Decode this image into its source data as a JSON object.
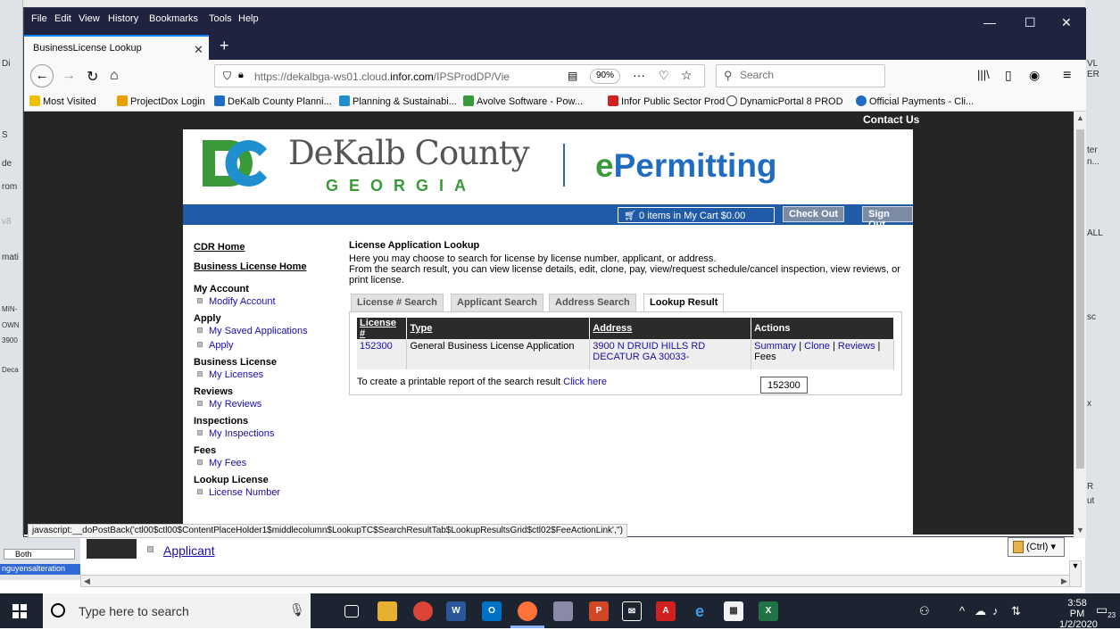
{
  "browser": {
    "menus": [
      "File",
      "Edit",
      "View",
      "History",
      "Bookmarks",
      "Tools",
      "Help"
    ],
    "tab_title": "BusinessLicense Lookup",
    "url_prefix": "https://dekalbga-ws01.cloud.",
    "url_domain": "infor.com",
    "url_suffix": "/IPSProdDP/Vie",
    "zoom": "90%",
    "search_placeholder": "Search",
    "bookmarks": [
      {
        "label": "Most Visited",
        "color": "#f0c000"
      },
      {
        "label": "ProjectDox Login",
        "color": "#e8a000"
      },
      {
        "label": "DeKalb County Planni...",
        "color": "#1f6cc0"
      },
      {
        "label": "Planning & Sustainabi...",
        "color": "#1f8fd0"
      },
      {
        "label": "Avolve Software - Pow...",
        "color": "#3a9a3a"
      },
      {
        "label": "Infor Public Sector Prod",
        "color": "#d02020"
      },
      {
        "label": "DynamicPortal 8 PROD",
        "color": "#444444"
      },
      {
        "label": "Official Payments - Cli...",
        "color": "#1f6cc0"
      }
    ],
    "status_text": "javascript:__doPostBack('ctl00$ctl00$ContentPlaceHolder1$middlecolumn$LookupTC$SearchResultTab$LookupResultsGrid$ctl02$FeeActionLink','')"
  },
  "page": {
    "contact_us": "Contact Us",
    "logo_county": "DeKalb County",
    "logo_state": "GEORGIA",
    "logo_epermit_e": "e",
    "logo_epermit_rest": "Permitting",
    "cart": {
      "count": "0",
      "items_in": "items in",
      "my_cart": "My Cart",
      "amount": "$0.00"
    },
    "check_out": "Check Out",
    "sign_out": "Sign Out",
    "nav": {
      "cdr_home": "CDR Home",
      "business_license_home": "Business License Home",
      "my_account": "My Account",
      "modify_account": "Modify Account",
      "apply": "Apply",
      "my_saved_applications": "My Saved Applications",
      "apply_link": "Apply",
      "business_license": "Business License",
      "my_licenses": "My Licenses",
      "reviews": "Reviews",
      "my_reviews": "My Reviews",
      "inspections": "Inspections",
      "my_inspections": "My Inspections",
      "fees": "Fees",
      "my_fees": "My Fees",
      "lookup_license": "Lookup License",
      "license_number": "License Number",
      "applicant": "Applicant"
    },
    "main": {
      "title": "License Application Lookup",
      "desc1": "Here you may choose to search for license by license number, applicant, or address.",
      "desc2": "From the search result, you can view license details, edit, clone, pay, view/request schedule/cancel inspection, view reviews, or print license.",
      "tabs": [
        "License # Search",
        "Applicant Search",
        "Address Search",
        "Lookup Result"
      ],
      "columns": [
        "License #",
        "Type",
        "Address",
        "Actions"
      ],
      "row": {
        "license": "152300",
        "type": "General Business License Application",
        "address": "3900 N DRUID HILLS RD DECATUR GA 30033-",
        "summary": "Summary",
        "clone": "Clone",
        "reviews": "Reviews",
        "fees": "Fees"
      },
      "printable_text": "To create a printable report of the search result",
      "click_here": "Click here",
      "tooltip": "152300"
    }
  },
  "background": {
    "left_labels": [
      "Di",
      "S",
      "de",
      "rom",
      "v8",
      "mati",
      "MIN-",
      "OWN",
      "3900",
      "Deca"
    ],
    "right_labels": [
      "VL",
      "ER",
      "ter",
      "n...",
      "ALL",
      "sc",
      "x",
      "R",
      "ut"
    ],
    "bottom_applicant": "Applicant",
    "bottom_both": "Both",
    "bottom_selected": "nguyensalteration",
    "paste_label": "(Ctrl) ▾"
  },
  "taskbar": {
    "search_placeholder": "Type here to search",
    "time": "3:58 PM",
    "date": "1/2/2020",
    "notif_count": "23"
  }
}
